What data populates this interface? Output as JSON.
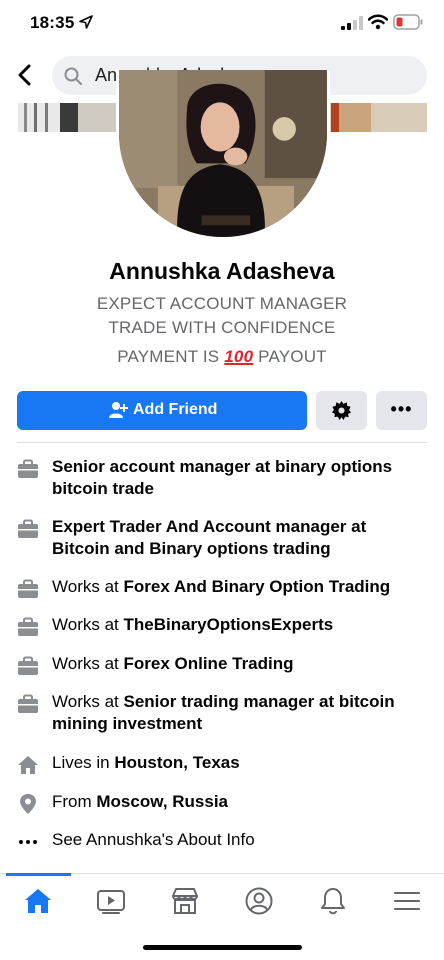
{
  "status_bar": {
    "time": "18:35"
  },
  "search": {
    "query": "Annushka Adasheva"
  },
  "profile": {
    "name": "Annushka Adasheva",
    "bio_line1": "EXPECT ACCOUNT MANAGER",
    "bio_line2": "TRADE WITH CONFIDENCE",
    "bio_line3_before": "PAYMENT IS ",
    "bio_line3_emoji": "100",
    "bio_line3_after": " PAYOUT"
  },
  "actions": {
    "add_friend_label": "Add Friend",
    "more_label": "•••"
  },
  "about": {
    "items": [
      {
        "icon": "briefcase-icon",
        "prefix": "",
        "bold": "Senior account manager at binary options bitcoin trade"
      },
      {
        "icon": "briefcase-icon",
        "prefix": "",
        "bold": "Expert Trader And Account manager at Bitcoin and Binary options trading"
      },
      {
        "icon": "briefcase-icon",
        "prefix": "Works at ",
        "bold": "Forex And Binary Option Trading"
      },
      {
        "icon": "briefcase-icon",
        "prefix": "Works at ",
        "bold": "TheBinaryOptionsExperts"
      },
      {
        "icon": "briefcase-icon",
        "prefix": "Works at ",
        "bold": "Forex Online Trading"
      },
      {
        "icon": "briefcase-icon",
        "prefix": "Works at ",
        "bold": "Senior trading manager at bitcoin mining investment"
      },
      {
        "icon": "home-icon",
        "prefix": "Lives in ",
        "bold": "Houston, Texas"
      },
      {
        "icon": "location-pin-icon",
        "prefix": "From ",
        "bold": "Moscow, Russia"
      }
    ],
    "see_about": "See Annushka's About Info",
    "see_about_icon": "more-dots-icon"
  },
  "nav": {
    "items": [
      "home-icon",
      "watch-icon",
      "marketplace-icon",
      "profile-icon",
      "notifications-icon",
      "menu-icon"
    ],
    "accent": "#1877f2"
  },
  "colors": {
    "accent": "#1877f2",
    "button_gray": "#e4e6eb",
    "secondary_text": "#65676b"
  }
}
